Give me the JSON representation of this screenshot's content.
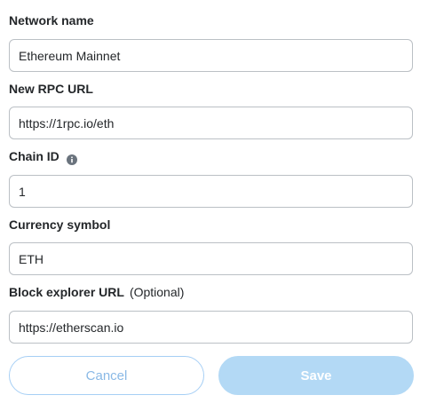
{
  "form": {
    "network_name": {
      "label": "Network name",
      "value": "Ethereum Mainnet"
    },
    "rpc_url": {
      "label": "New RPC URL",
      "value": "https://1rpc.io/eth"
    },
    "chain_id": {
      "label": "Chain ID",
      "info_icon": "info-icon",
      "value": "1"
    },
    "currency_symbol": {
      "label": "Currency symbol",
      "value": "ETH"
    },
    "block_explorer": {
      "label": "Block explorer URL",
      "optional_note": "(Optional)",
      "value": "https://etherscan.io"
    }
  },
  "actions": {
    "cancel_label": "Cancel",
    "save_label": "Save"
  },
  "colors": {
    "text": "#24272a",
    "input_border": "#bbc0c5",
    "cancel_border": "#a6cff5",
    "cancel_text": "#8ab9e6",
    "save_bg_disabled": "#b3d9f5",
    "info_icon": "#6a737d"
  }
}
